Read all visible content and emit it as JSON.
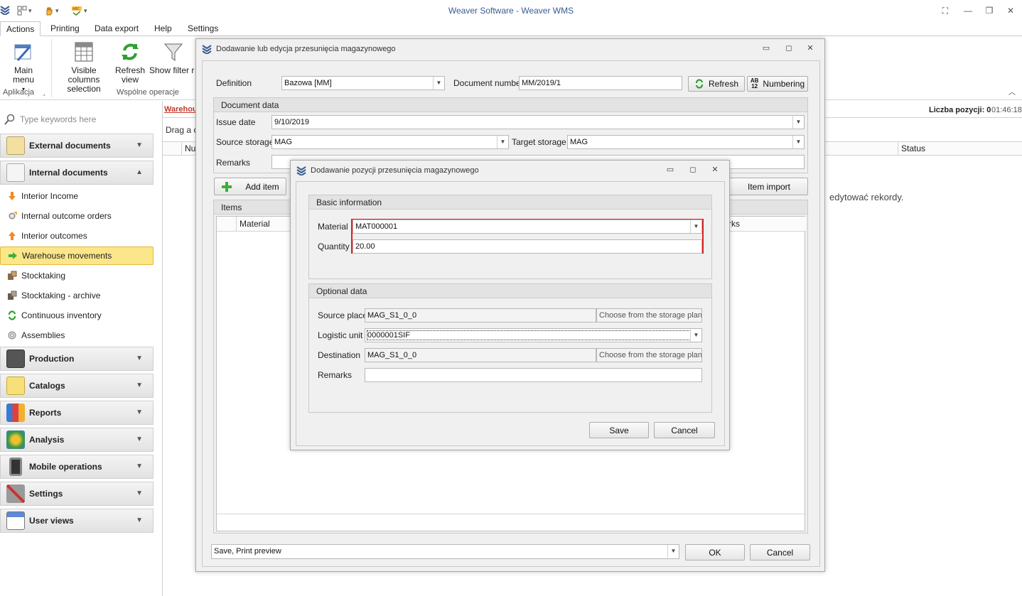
{
  "app": {
    "title": "Weaver Software - Weaver WMS"
  },
  "ribbon": {
    "tabs": [
      "Actions",
      "Printing",
      "Data export",
      "Help",
      "Settings"
    ],
    "buttons": {
      "main_menu": "Main menu",
      "visible_columns_1": "Visible columns",
      "visible_columns_2": "selection",
      "refresh_1": "Refresh",
      "refresh_2": "view",
      "show_filter": "Show filter ro"
    },
    "groups": {
      "aplikacja": "Aplikacja",
      "wspolne": "Wspólne operacje"
    }
  },
  "nav": {
    "search_placeholder": "Type keywords here",
    "groups": {
      "external": "External documents",
      "internal": "Internal documents",
      "production": "Production",
      "catalogs": "Catalogs",
      "reports": "Reports",
      "analysis": "Analysis",
      "mobile": "Mobile operations",
      "settings": "Settings",
      "user_views": "User views"
    },
    "internal_items": [
      "Interior Income",
      "Internal outcome orders",
      "Interior outcomes",
      "Warehouse movements",
      "Stocktaking",
      "Stocktaking - archive",
      "Continuous inventory",
      "Assemblies"
    ]
  },
  "main": {
    "tab_label": "Warehou",
    "drag_text": "Drag a c",
    "col_num": "Nu",
    "col_status": "Status",
    "count_label": "Liczba pozycji: 0",
    "time": "01:46:18",
    "empty_msg": "edytować rekordy."
  },
  "outer_dialog": {
    "title": "Dodawanie lub edycja przesunięcia magazynowego",
    "definition_label": "Definition",
    "definition_value": "Bazowa [MM]",
    "doc_number_label": "Document number",
    "doc_number_value": "MM/2019/1",
    "refresh_btn": "Refresh",
    "numbering_btn": "Numbering",
    "doc_data_header": "Document data",
    "issue_date_label": "Issue date",
    "issue_date_value": "9/10/2019",
    "source_storage_label": "Source storage",
    "source_storage_value": "MAG",
    "target_storage_label": "Target storage",
    "target_storage_value": "MAG",
    "remarks_label": "Remarks",
    "add_item_btn": "Add item",
    "item_import_btn": "Item import",
    "items_header": "Items",
    "col_material": "Material",
    "col_remarks": "rks",
    "save_mode_value": "Save, Print preview",
    "ok_btn": "OK",
    "cancel_btn": "Cancel"
  },
  "inner_dialog": {
    "title": "Dodawanie pozycji przesunięcia magazynowego",
    "basic_header": "Basic information",
    "material_label": "Material",
    "material_value": "MAT000001",
    "quantity_label": "Quantity",
    "quantity_value": "20.00",
    "optional_header": "Optional data",
    "source_place_label": "Source place",
    "source_place_value": "MAG_S1_0_0",
    "choose_plan_1": "Choose from the storage plan",
    "logistic_unit_label": "Logistic unit",
    "logistic_unit_value": "0000001SIF",
    "destination_label": "Destination",
    "destination_value": "MAG_S1_0_0",
    "choose_plan_2": "Choose from the storage plan",
    "remarks_label": "Remarks",
    "save_btn": "Save",
    "cancel_btn": "Cancel"
  },
  "colors": {
    "highlight": "#e02020",
    "selected_nav": "#fbe68a",
    "title_text": "#3a5a92"
  }
}
